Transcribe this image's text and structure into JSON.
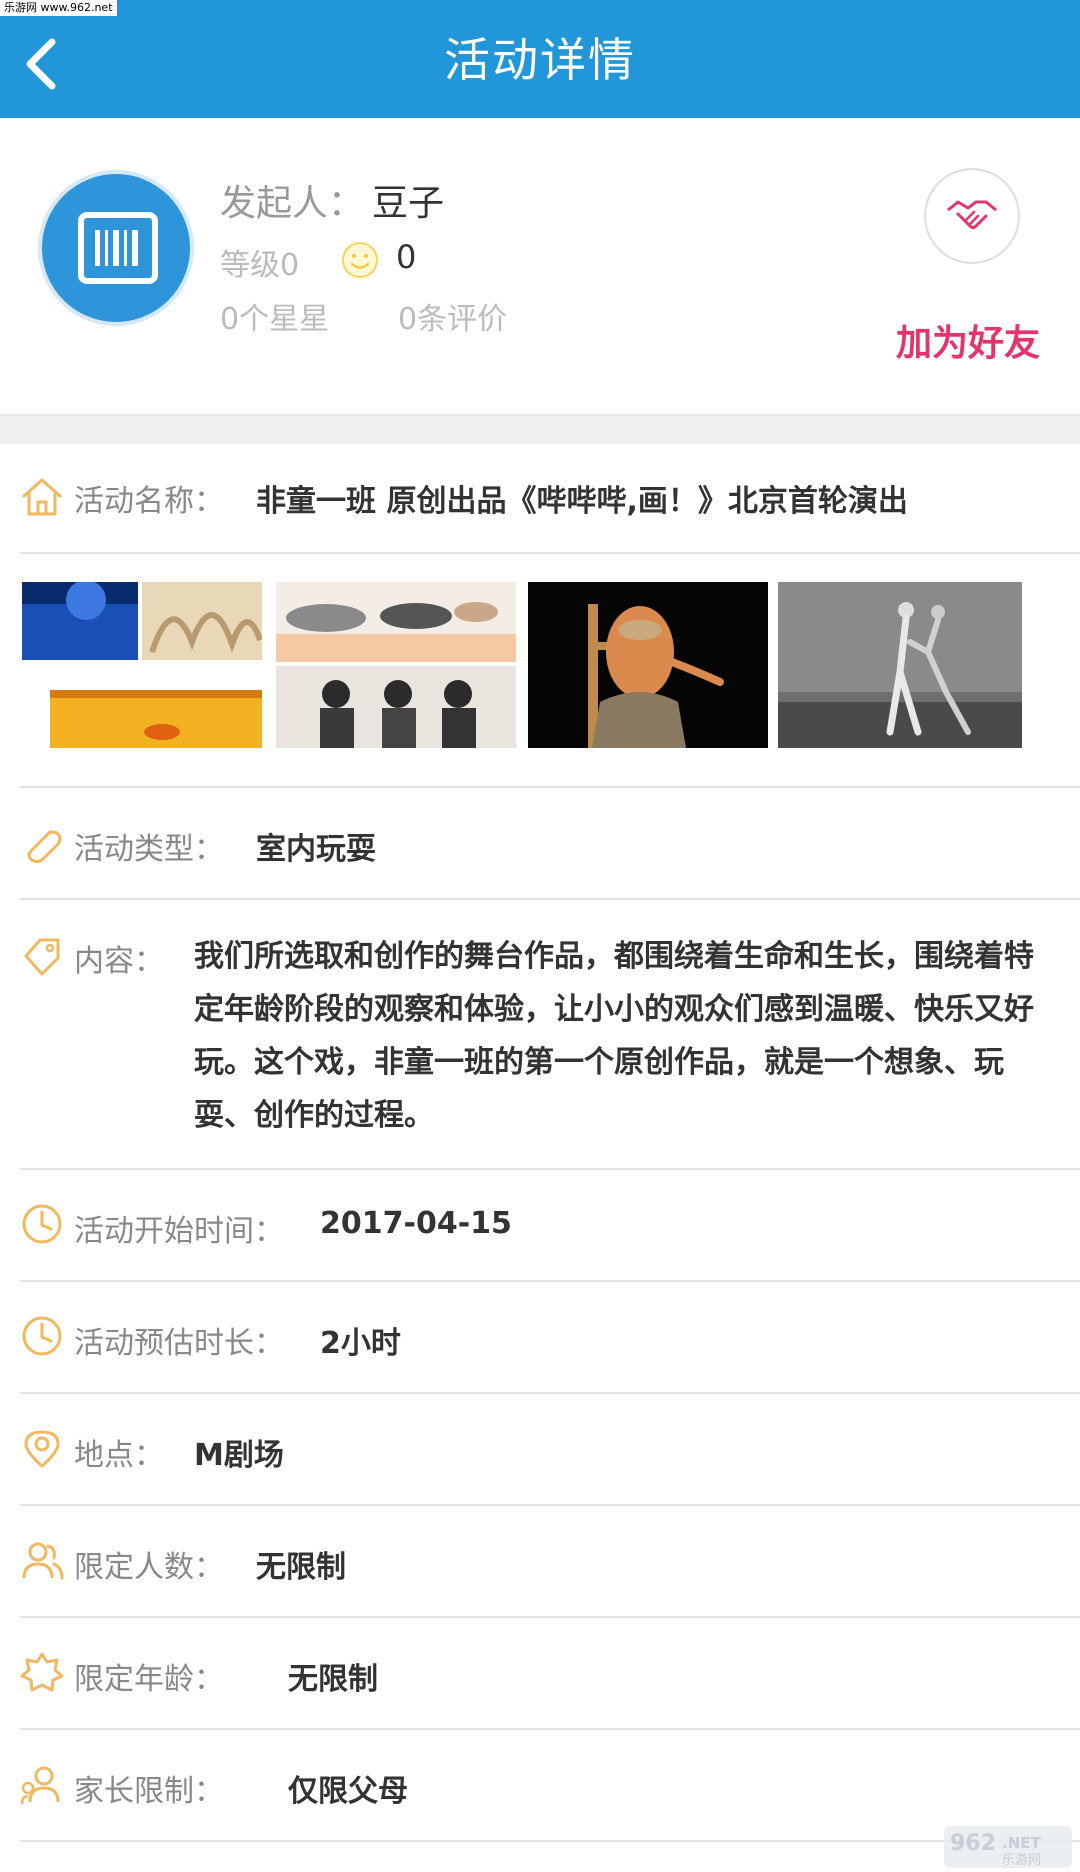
{
  "watermark": "乐游网 www.962.net",
  "navbar": {
    "title": "活动详情",
    "bg_color": "#2196d9"
  },
  "profile": {
    "initiator_label": "发起人：",
    "initiator_name": "豆子",
    "level": "等级0",
    "level_score": "0",
    "stars": "0个星星",
    "reviews": "0条评价",
    "add_friend": "加为好友",
    "accent_color": "#e6336b"
  },
  "details": {
    "name": {
      "label": "活动名称：",
      "value": "非童一班 原创出品《哔哔哔,画！》北京首轮演出",
      "icon": "home-icon"
    },
    "type": {
      "label": "活动类型：",
      "value": "室内玩耍",
      "icon": "paperclip-icon"
    },
    "content": {
      "label": "内容：",
      "value": "我们所选取和创作的舞台作品，都围绕着生命和生长，围绕着特定年龄阶段的观察和体验，让小小的观众们感到温暖、快乐又好玩。这个戏，非童一班的第一个原创作品，就是一个想象、玩耍、创作的过程。",
      "icon": "tag-icon"
    },
    "start_time": {
      "label": "活动开始时间：",
      "value": "2017-04-15",
      "icon": "clock-icon"
    },
    "duration": {
      "label": "活动预估时长：",
      "value": "2小时",
      "icon": "clock-icon"
    },
    "location": {
      "label": "地点：",
      "value": "M剧场",
      "icon": "location-pin-icon"
    },
    "max_people": {
      "label": "限定人数：",
      "value": "无限制",
      "icon": "people-icon"
    },
    "age_limit": {
      "label": "限定年龄：",
      "value": "无限制",
      "icon": "badge-icon"
    },
    "parent_limit": {
      "label": "家长限制：",
      "value": "仅限父母",
      "icon": "parent-icon"
    }
  },
  "photos": [
    "stage-collage-photo",
    "dancers-group-photo",
    "performer-photo",
    "dance-duo-photo"
  ],
  "footer_logo": "962.NET 乐游网"
}
